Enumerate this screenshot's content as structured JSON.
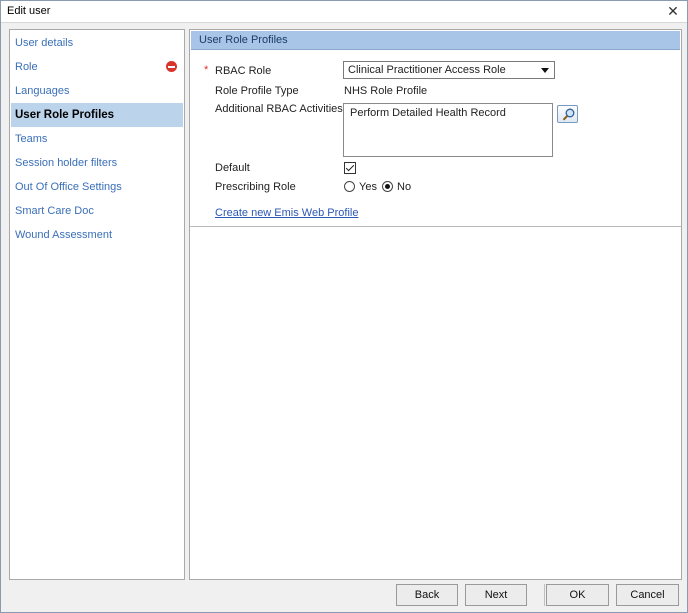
{
  "window": {
    "title": "Edit user",
    "close_glyph": "✕"
  },
  "sidebar": {
    "items": [
      {
        "label": "User details"
      },
      {
        "label": "Role",
        "icon": "error-icon"
      },
      {
        "label": "Languages"
      },
      {
        "label": "User Role Profiles",
        "active": true
      },
      {
        "label": "Teams"
      },
      {
        "label": "Session holder filters"
      },
      {
        "label": "Out Of Office Settings"
      },
      {
        "label": "Smart Care Doc"
      },
      {
        "label": "Wound Assessment"
      }
    ]
  },
  "panel": {
    "header": "User Role Profiles",
    "required_mark": "*",
    "rbac_role": {
      "label": "RBAC Role",
      "value": "Clinical Practitioner Access Role"
    },
    "role_profile_type": {
      "label": "Role Profile Type",
      "value": "NHS Role Profile"
    },
    "additional_activities": {
      "label": "Additional RBAC Activities",
      "value": "Perform Detailed Health Record"
    },
    "default": {
      "label": "Default",
      "checked": true
    },
    "prescribing_role": {
      "label": "Prescribing Role",
      "yes_label": "Yes",
      "no_label": "No",
      "selected": "No"
    },
    "create_link": "Create new Emis Web Profile"
  },
  "buttons": {
    "back": "Back",
    "next": "Next",
    "ok": "OK",
    "cancel": "Cancel"
  },
  "colors": {
    "accent": "#a8c4e6",
    "active_item": "#bcd3ec",
    "link": "#3a6fb7",
    "error": "#d9342b"
  }
}
